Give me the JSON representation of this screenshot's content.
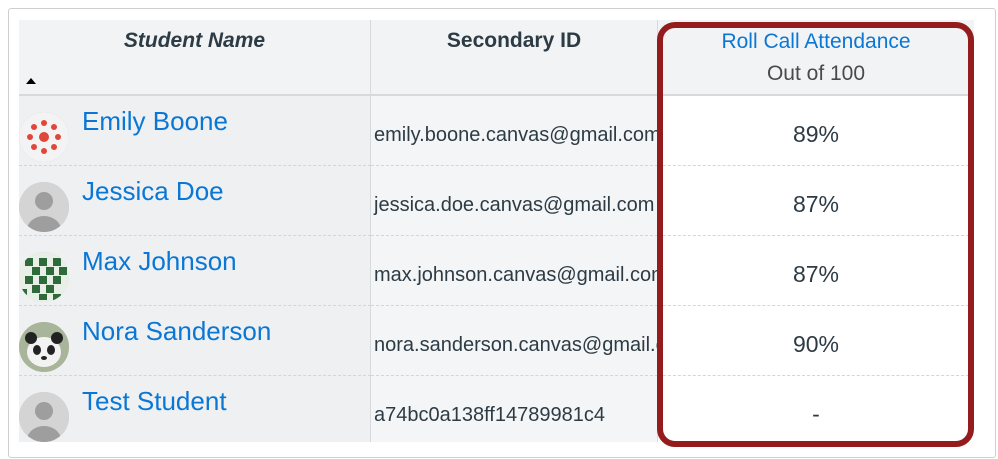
{
  "columns": {
    "student_name": "Student Name",
    "secondary_id": "Secondary ID",
    "assignment": "Roll Call Attendance",
    "out_of": "Out of 100"
  },
  "students": [
    {
      "name": "Emily Boone",
      "secondary_id": "emily.boone.canvas@gmail.com",
      "grade": "89%",
      "avatar": "canvas-logo-icon"
    },
    {
      "name": "Jessica Doe",
      "secondary_id": "jessica.doe.canvas@gmail.com",
      "grade": "87%",
      "avatar": "default-user-icon"
    },
    {
      "name": "Max Johnson",
      "secondary_id": "max.johnson.canvas@gmail.com",
      "grade": "87%",
      "avatar": "pattern-avatar-icon"
    },
    {
      "name": "Nora Sanderson",
      "secondary_id": "nora.sanderson.canvas@gmail.com",
      "grade": "90%",
      "avatar": "panda-avatar-icon"
    },
    {
      "name": "Test Student",
      "secondary_id": "a74bc0a138ff14789981c4",
      "grade": "-",
      "avatar": "default-user-icon"
    }
  ],
  "colors": {
    "link": "#0a77d5",
    "highlight_border": "#951c1c",
    "header_bg": "#f2f3f4"
  }
}
